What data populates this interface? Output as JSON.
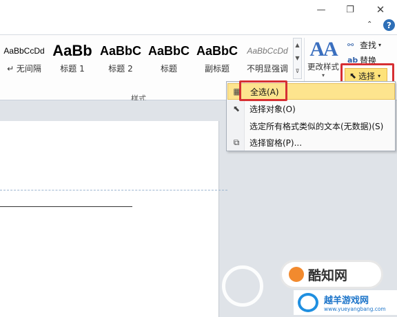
{
  "window": {
    "minimize_icon": "minimize-icon",
    "minimize_glyph": "—",
    "restore_icon": "restore-icon",
    "restore_glyph": "❐",
    "close_icon": "close-icon",
    "close_glyph": "✕",
    "collapse_glyph": "⌃",
    "help_glyph": "?"
  },
  "ribbon": {
    "styles_group_label": "样式",
    "styles": [
      {
        "sample": "AaBbCcDd",
        "name": "↵ 无间隔"
      },
      {
        "sample": "AaBb",
        "name": "标题 1"
      },
      {
        "sample": "AaBbC",
        "name": "标题 2"
      },
      {
        "sample": "AaBbC",
        "name": "标题"
      },
      {
        "sample": "AaBbC",
        "name": "副标题"
      },
      {
        "sample": "AaBbCcDd",
        "name": "不明显强调"
      }
    ],
    "gallery_scroll": {
      "up": "▲",
      "down": "▼",
      "more": "⊽"
    },
    "change_styles": {
      "icon_glyph": "AA",
      "label": "更改样式",
      "caret": "▾"
    },
    "editing": {
      "find_label": "查找",
      "find_caret": "▾",
      "replace_label": "替换",
      "select_label": "选择",
      "select_caret": "▾",
      "accent_color": "#fde27a"
    }
  },
  "select_menu": {
    "items": [
      {
        "label": "全选(A)",
        "icon": "select-all-icon",
        "active": true
      },
      {
        "label": "选择对象(O)",
        "icon": "pointer-icon",
        "active": false
      },
      {
        "label": "选定所有格式类似的文本(无数据)(S)",
        "icon": "",
        "active": false
      },
      {
        "label": "选择窗格(P)...",
        "icon": "selection-pane-icon",
        "active": false
      }
    ],
    "highlight_color": "#d62f33"
  },
  "watermark": {
    "badge_text": "酷知网",
    "site_name": "越羊游戏网",
    "site_url": "www.yueyangbang.com"
  }
}
